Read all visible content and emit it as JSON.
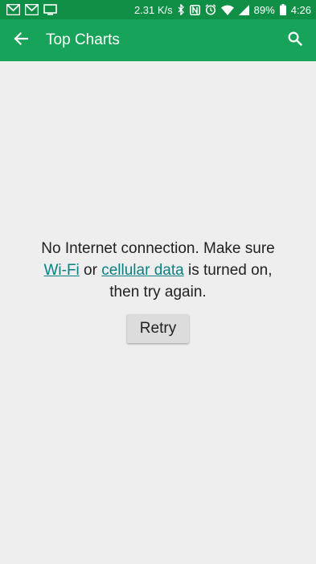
{
  "status_bar": {
    "net_speed": "2.31 K/s",
    "battery": "89%",
    "time": "4:26",
    "left_icons": [
      "gmail-icon",
      "gmail-icon",
      "cast-icon"
    ],
    "right_icons": [
      "bluetooth-icon",
      "nfc-icon",
      "alarm-icon",
      "wifi-icon",
      "signal-icon",
      "battery-icon"
    ]
  },
  "app_bar": {
    "title": "Top Charts",
    "back_icon": "arrow-back-icon",
    "search_icon": "search-icon"
  },
  "error": {
    "line1": "No Internet connection. Make sure",
    "wifi_link": "Wi-Fi",
    "or_text": " or ",
    "cellular_link": "cellular data",
    "line2_suffix": " is turned on,",
    "line3": "then try again."
  },
  "retry_label": "Retry",
  "colors": {
    "status_bar": "#0f8f46",
    "app_bar": "#17a35a",
    "background": "#eeeeee",
    "link": "#0a7f82"
  }
}
